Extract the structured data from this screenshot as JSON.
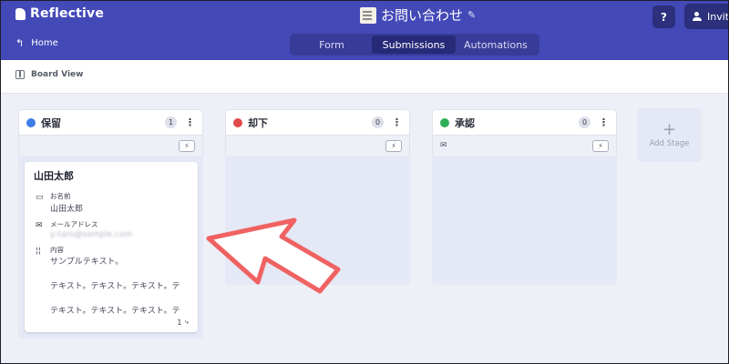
{
  "header": {
    "app_name": "Reflective",
    "form_title": "お問い合わせ",
    "help_label": "?",
    "invite_label": "Invite",
    "home_label": "Home",
    "tabs": [
      {
        "label": "Form",
        "active": false
      },
      {
        "label": "Submissions",
        "active": true
      },
      {
        "label": "Automations",
        "active": false
      }
    ]
  },
  "toolbar": {
    "board_view_label": "Board View"
  },
  "columns": [
    {
      "title": "保留",
      "count": "1",
      "color": "#3f7de8",
      "card": {
        "title": "山田太郎",
        "fields": [
          {
            "label": "お名前",
            "value": "山田太郎",
            "icon": "name-card-icon"
          },
          {
            "label": "メールアドレス",
            "value": "y-taro@sample.com",
            "icon": "mail-icon"
          },
          {
            "label": "内容",
            "lines": [
              "サンプルテキスト。",
              "テキスト。テキスト。テキスト。テ",
              "テキスト。テキスト。テキスト。テ"
            ],
            "icon": "text-icon"
          }
        ],
        "footer_count": "1"
      }
    },
    {
      "title": "却下",
      "count": "0",
      "color": "#e04a4a"
    },
    {
      "title": "承認",
      "count": "0",
      "color": "#2fae55"
    }
  ],
  "add_stage": {
    "label": "Add Stage"
  },
  "annotation": {
    "arrow_color": "#f06262"
  }
}
